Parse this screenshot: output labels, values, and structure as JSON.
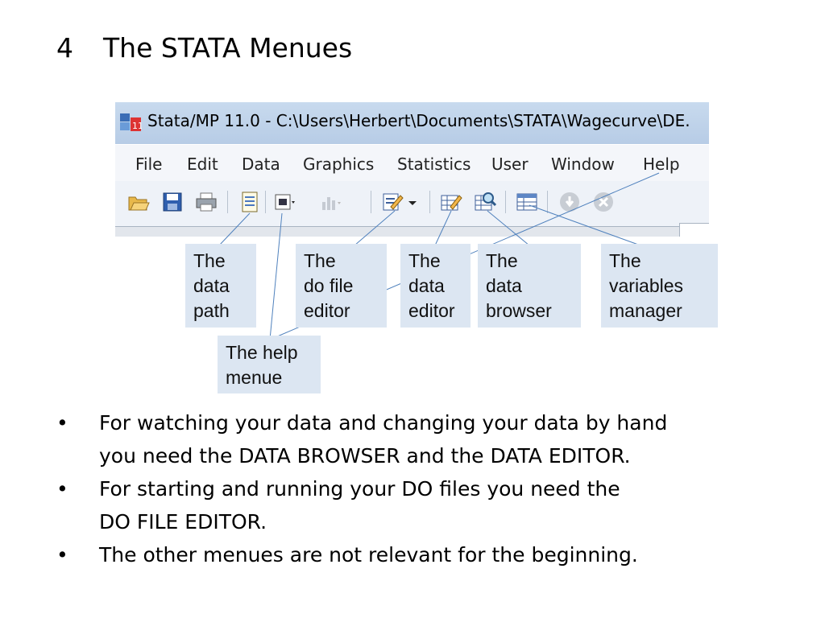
{
  "slide": {
    "number": "4",
    "title": "The STATA Menues"
  },
  "window": {
    "title": "Stata/MP 11.0 - C:\\Users\\Herbert\\Documents\\STATA\\Wagecurve\\DE.",
    "menu": [
      "File",
      "Edit",
      "Data",
      "Graphics",
      "Statistics",
      "User",
      "Window",
      "Help"
    ],
    "toolbar_icons": [
      "open-icon",
      "save-icon",
      "print-icon",
      "log-icon",
      "viewer-icon",
      "graph-icon",
      "do-file-editor-icon",
      "data-editor-icon",
      "data-browser-icon",
      "variables-manager-icon",
      "break-icon",
      "clear-icon"
    ]
  },
  "callouts": {
    "data_path": [
      "The",
      "data",
      "path"
    ],
    "do_file_editor": [
      "The",
      "do file",
      "editor"
    ],
    "data_editor": [
      "The",
      "data",
      "editor"
    ],
    "data_browser": [
      "The",
      "data",
      "browser"
    ],
    "variables_manager": [
      "The",
      "variables",
      "manager"
    ],
    "help_menue": [
      "The help",
      "menue"
    ]
  },
  "bullets": [
    {
      "marker": "•",
      "lines": [
        "For watching your data and changing your data by hand",
        "you need the DATA BROWSER and the DATA EDITOR."
      ]
    },
    {
      "marker": "•",
      "lines": [
        "For  starting and running your DO files you need the",
        "DO FILE EDITOR."
      ]
    },
    {
      "marker": "•",
      "lines": [
        "The other menues are not relevant for the beginning."
      ]
    }
  ]
}
